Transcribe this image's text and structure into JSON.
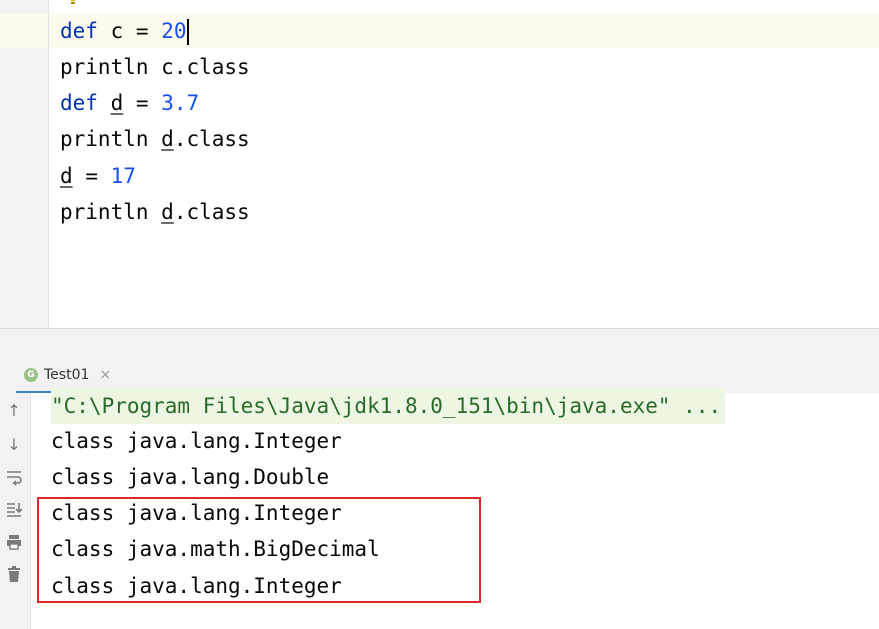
{
  "editor": {
    "lines": [
      {
        "kw": "def",
        "name": "c",
        "op": "=",
        "value": "20"
      },
      {
        "call": "println",
        "target": "c",
        "suffix": ".class"
      },
      {
        "kw": "def",
        "name": "d",
        "op": "=",
        "value": "3.7"
      },
      {
        "call": "println",
        "target": "d",
        "suffix": ".class"
      },
      {
        "name": "d",
        "op": "=",
        "value": "17"
      },
      {
        "call": "println",
        "target": "d",
        "suffix": ".class"
      }
    ]
  },
  "run_panel": {
    "tab_label": "Test01",
    "tab_badge": "G",
    "console_lines": [
      "\"C:\\Program Files\\Java\\jdk1.8.0_151\\bin\\java.exe\" ...",
      "class java.lang.Integer",
      "class java.lang.Double",
      "class java.lang.Integer",
      "class java.math.BigDecimal",
      "class java.lang.Integer"
    ]
  },
  "colors": {
    "keyword": "#0033b3",
    "number": "#1750eb",
    "highlight_border": "#d9292f",
    "tab_underline": "#4083c9"
  }
}
